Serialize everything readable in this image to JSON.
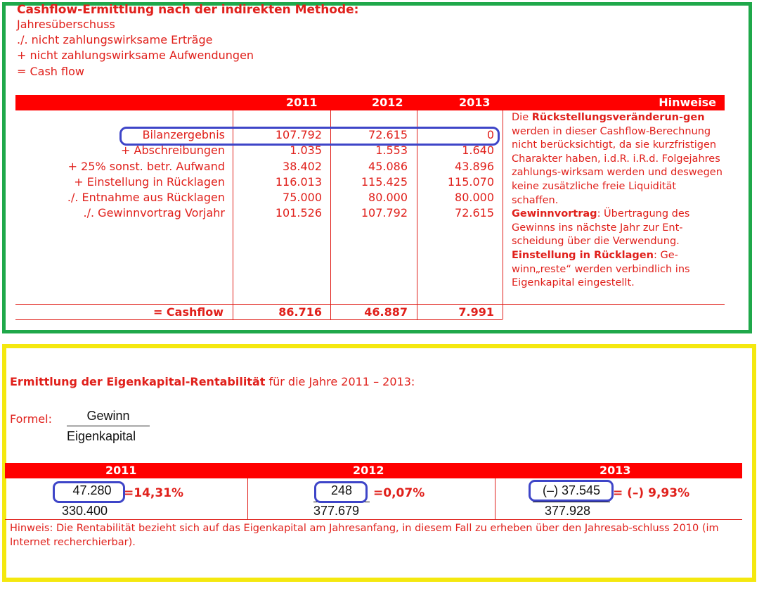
{
  "cashflow": {
    "title": "Cashflow-Ermittlung nach der indirekten Methode:",
    "intro": [
      "Jahresüberschuss",
      "./. nicht zahlungswirksame Erträge",
      "+ nicht zahlungswirksame Aufwendungen",
      "= Cash flow"
    ],
    "years": [
      "2011",
      "2012",
      "2013"
    ],
    "hint_header": "Hinweise",
    "rows": [
      {
        "label": "Bilanzergebnis",
        "values": [
          "107.792",
          "72.615",
          "0"
        ]
      },
      {
        "label": "+ Abschreibungen",
        "values": [
          "1.035",
          "1.553",
          "1.640"
        ]
      },
      {
        "label": "+ 25% sonst. betr. Aufwand",
        "values": [
          "38.402",
          "45.086",
          "43.896"
        ]
      },
      {
        "label": "+ Einstellung in Rücklagen",
        "values": [
          "116.013",
          "115.425",
          "115.070"
        ]
      },
      {
        "label": "./. Entnahme aus Rücklagen",
        "values": [
          "75.000",
          "80.000",
          "80.000"
        ]
      },
      {
        "label": "./. Gewinnvortrag Vorjahr",
        "values": [
          "101.526",
          "107.792",
          "72.615"
        ]
      }
    ],
    "total": {
      "label": "= Cashflow",
      "values": [
        "86.716",
        "46.887",
        "7.991"
      ]
    },
    "hint": {
      "p1_pre": "Die ",
      "p1_bold": "Rückstellungsveränderun-gen",
      "p1_post": " werden in dieser Cashflow-Berechnung nicht berücksichtigt, da sie kurzfristigen Charakter haben, i.d.R. i.R.d. Folgejahres zahlungs-wirksam werden und deswegen keine zusätzliche freie Liquidität schaffen.",
      "p2_bold": "Gewinnvortrag",
      "p2_post": ": Übertragung des Gewinns ins nächste Jahr zur Ent-scheidung über die Verwendung.",
      "p3_bold": "Einstellung in Rücklagen",
      "p3_post": ": Ge-winn„reste“ werden verbindlich ins Eigenkapital eingestellt."
    }
  },
  "rentabilitaet": {
    "title_bold": "Ermittlung der Eigenkapital-Rentabilität",
    "title_rest": " für die Jahre 2011 – 2013:",
    "formel_label": "Formel:",
    "formel_numerator": "Gewinn",
    "formel_denominator": "Eigenkapital",
    "years": [
      "2011",
      "2012",
      "2013"
    ],
    "cells": [
      {
        "numerator": "47.280",
        "denominator": "330.400",
        "result": "=14,31%"
      },
      {
        "numerator": "248",
        "denominator": "377.679",
        "result": "=0,07%"
      },
      {
        "numerator": "(–) 37.545",
        "denominator": "377.928",
        "result": "= (–) 9,93%"
      }
    ],
    "note": "Hinweis: Die Rentabilität bezieht sich auf das Eigenkapital am Jahresanfang, in diesem Fall zu erheben über den Jahresab-schluss 2010 (im Internet recherchierbar)."
  }
}
